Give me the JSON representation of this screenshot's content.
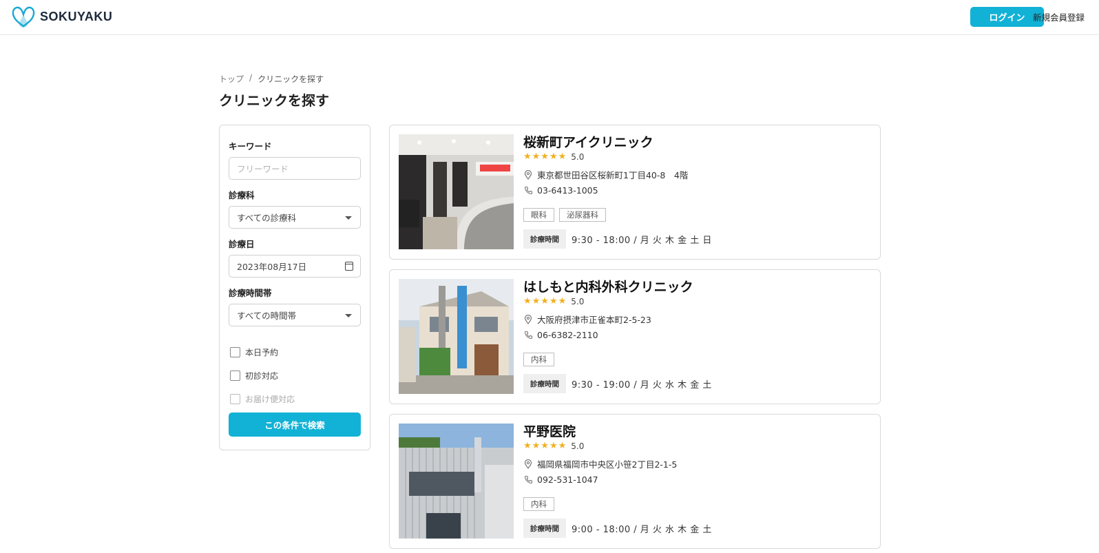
{
  "header": {
    "brand": "SOKUYAKU",
    "login_label": "ログイン",
    "register_label": "新規会員登録"
  },
  "breadcrumb": {
    "home": "トップ",
    "separator": "/",
    "current": "クリニックを探す"
  },
  "page_title": "クリニックを探す",
  "filters": {
    "keyword_label": "キーワード",
    "keyword_placeholder": "フリーワード",
    "department_label": "診療科",
    "department_value": "すべての診療科",
    "date_label": "診療日",
    "date_value": "2023年08月17日",
    "time_label": "診療時間帯",
    "time_value": "すべての時間帯",
    "checkboxes": [
      {
        "label": "本日予約",
        "enabled": true
      },
      {
        "label": "初診対応",
        "enabled": true
      },
      {
        "label": "お届け便対応",
        "enabled": false
      }
    ],
    "search_button": "この条件で検索"
  },
  "clinics": [
    {
      "name": "桜新町アイクリニック",
      "stars": "★★★★★",
      "rating": "5.0",
      "address": "東京都世田谷区桜新町1丁目40-8　4階",
      "phone": "03-6413-1005",
      "tags": [
        "眼科",
        "泌尿器科"
      ],
      "hours_label": "診療時間",
      "hours": "9:30 - 18:00 / 月 火 木 金 土 日"
    },
    {
      "name": "はしもと内科外科クリニック",
      "stars": "★★★★★",
      "rating": "5.0",
      "address": "大阪府摂津市正雀本町2-5-23",
      "phone": "06-6382-2110",
      "tags": [
        "内科"
      ],
      "hours_label": "診療時間",
      "hours": "9:30 - 19:00 / 月 火 水 木 金 土"
    },
    {
      "name": "平野医院",
      "stars": "★★★★★",
      "rating": "5.0",
      "address": "福岡県福岡市中央区小笹2丁目2-1-5",
      "phone": "092-531-1047",
      "tags": [
        "内科"
      ],
      "hours_label": "診療時間",
      "hours": "9:00 - 18:00 / 月 火 水 木 金 土"
    }
  ],
  "colors": {
    "accent": "#12b2d6",
    "star": "#f2b01e",
    "border": "#d9d9d9"
  }
}
